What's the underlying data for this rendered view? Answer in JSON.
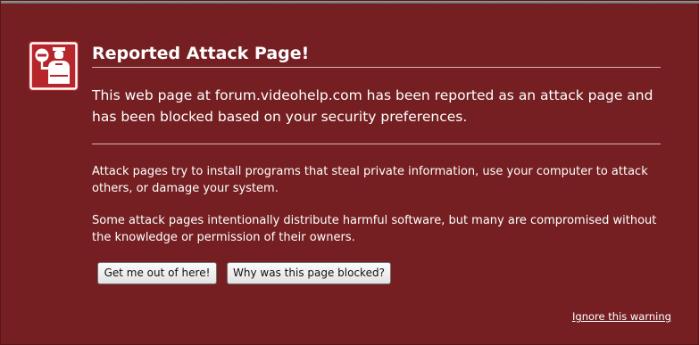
{
  "dialog": {
    "title": "Reported Attack Page!",
    "lead": "This web page at forum.videohelp.com has been reported as an attack page and has been blocked based on your security preferences.",
    "paragraph1": "Attack pages try to install programs that steal private information, use your computer to attack others, or damage your system.",
    "paragraph2": "Some attack pages intentionally distribute harmful software, but many are compromised without the knowledge or permission of their owners.",
    "buttons": {
      "get_out": "Get me out of here!",
      "why_blocked": "Why was this page blocked?"
    },
    "ignore_link": "Ignore this warning",
    "icon": "police-officer-stop-icon"
  },
  "colors": {
    "background": "#751f22",
    "icon_background": "#b6262b",
    "text": "#ffffff",
    "button": "#ececec"
  }
}
